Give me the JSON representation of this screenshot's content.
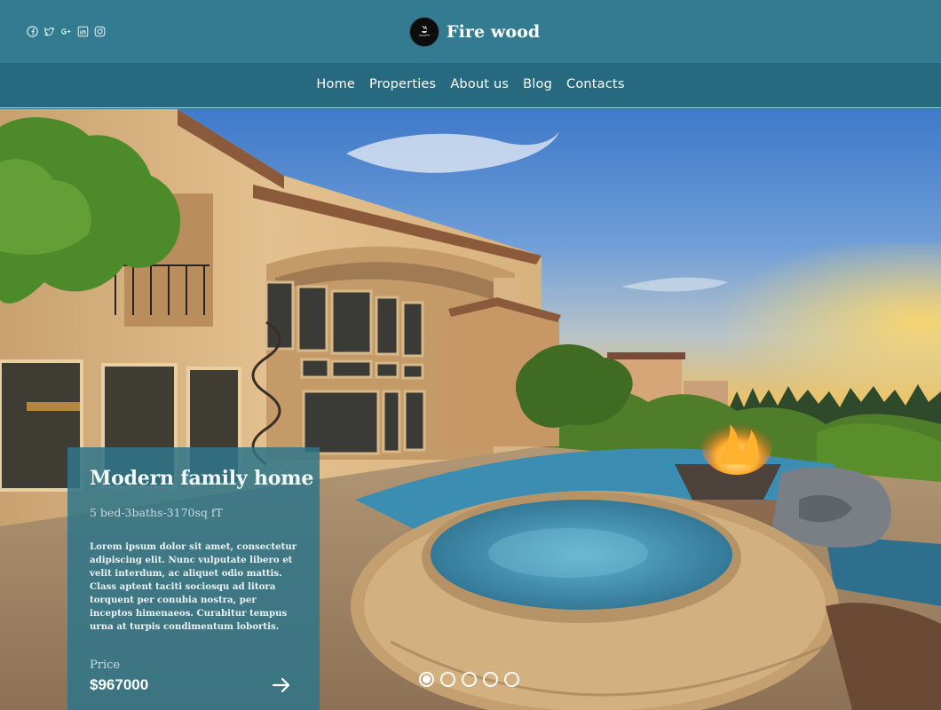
{
  "brand": {
    "name": "Fire wood",
    "logo_icon": "firewood-logo-icon"
  },
  "socials": [
    "facebook-icon",
    "twitter-icon",
    "google-plus-icon",
    "linkedin-icon",
    "instagram-icon"
  ],
  "nav": [
    "Home",
    "Properties",
    "About us",
    "Blog",
    "Contacts"
  ],
  "listing": {
    "title": "Modern family home",
    "subtitle": "5 bed-3baths-3170sq fT",
    "description": "Lorem ipsum dolor sit amet, consectetur adipiscing elit. Nunc vulputate libero et velit interdum, ac aliquet odio mattis. Class aptent taciti sociosqu ad litora torquent per conubia nostra, per inceptos himenaeos. Curabitur tempus urna at turpis condimentum lobortis.",
    "price_label": "Price",
    "price": "$967000",
    "next_icon": "arrow-right-icon"
  },
  "slider": {
    "count": 5,
    "active": 1
  },
  "colors": {
    "header": "#337b90",
    "nav": "#276a80",
    "card": "#2f7688"
  }
}
